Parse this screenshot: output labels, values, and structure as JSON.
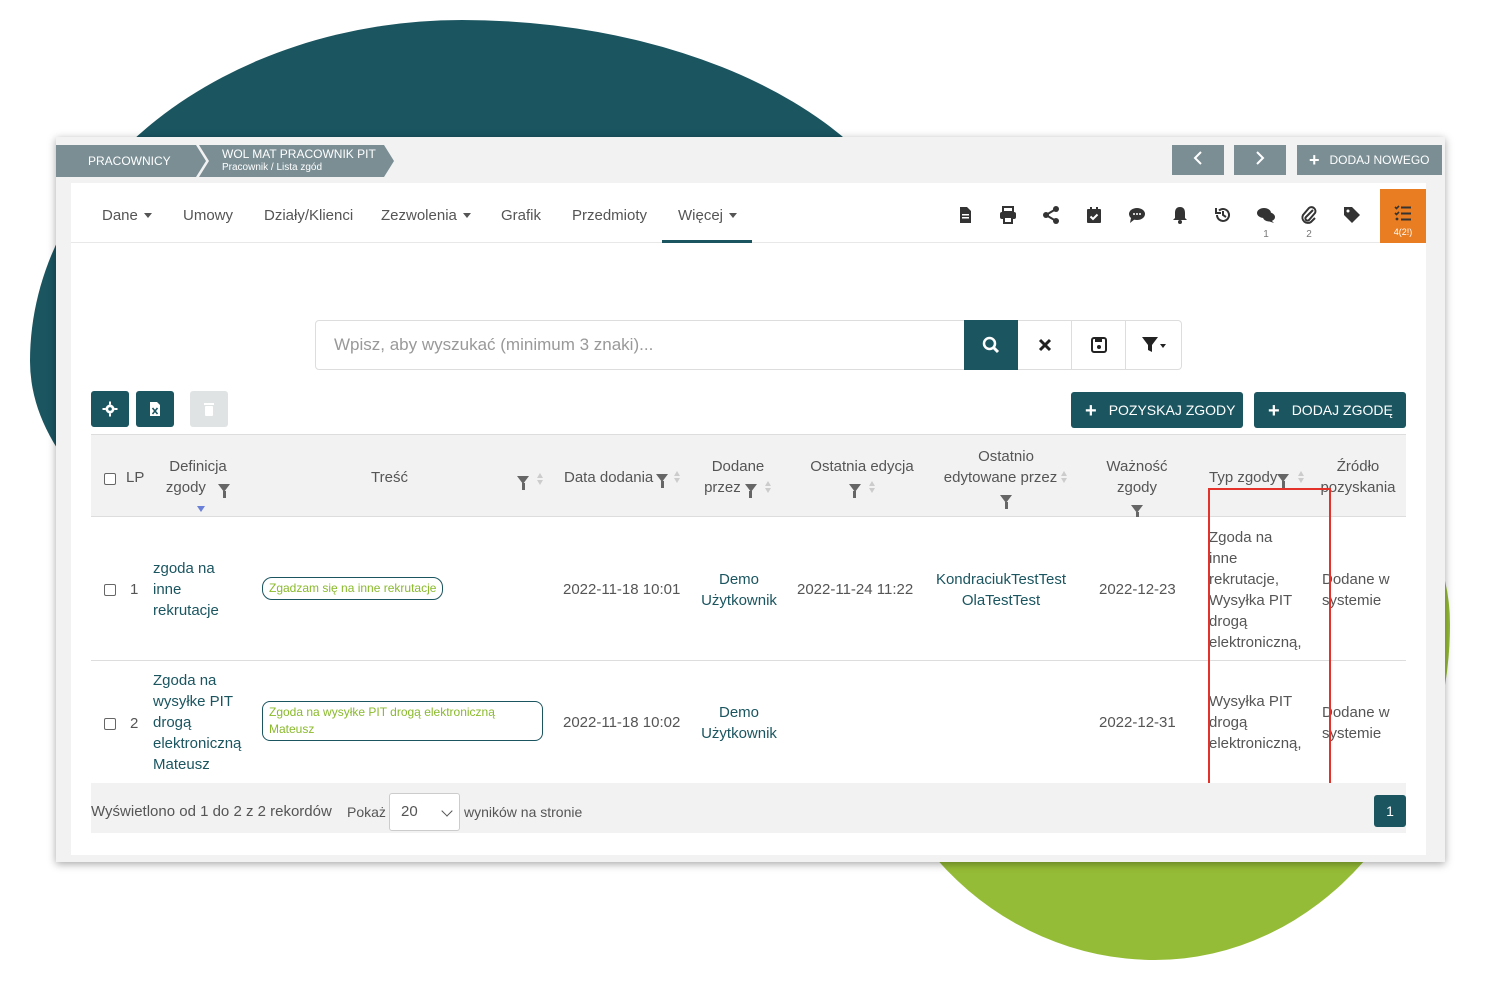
{
  "breadcrumb": {
    "root": "PRACOWNICY",
    "current_title": "WOL MAT PRACOWNIK PIT",
    "current_sub": "Pracownik / Lista zgód"
  },
  "header_buttons": {
    "add_new": "DODAJ NOWEGO"
  },
  "tabs": [
    {
      "label": "Dane"
    },
    {
      "label": "Umowy"
    },
    {
      "label": "Działy/Klienci"
    },
    {
      "label": "Zezwolenia"
    },
    {
      "label": "Grafik"
    },
    {
      "label": "Przedmioty"
    },
    {
      "label": "Więcej"
    }
  ],
  "icon_counts": {
    "comments": "1",
    "attachments": "2",
    "tasks": "4(2!)"
  },
  "search": {
    "placeholder": "Wpisz, aby wyszukać (minimum 3 znaki)..."
  },
  "actions": {
    "obtain": "POZYSKAJ ZGODY",
    "add": "DODAJ ZGODĘ"
  },
  "table": {
    "headers": {
      "lp": "LP",
      "definition_l1": "Definicja",
      "definition_l2": "zgody",
      "content": "Treść",
      "date_added": "Data dodania",
      "added_by_l1": "Dodane",
      "added_by_l2": "przez",
      "last_edit": "Ostatnia edycja",
      "last_edited_by_l1": "Ostatnio",
      "last_edited_by_l2": "edytowane przez",
      "validity": "Ważność zgody",
      "type": "Typ zgody",
      "source_l1": "Źródło",
      "source_l2": "pozyskania"
    },
    "rows": [
      {
        "lp": "1",
        "definition": [
          "zgoda na",
          "inne",
          "rekrutacje"
        ],
        "content": "Zgadzam się na inne rekrutacje",
        "date_added": "2022-11-18 10:01",
        "added_by": [
          "Demo",
          "Użytkownik"
        ],
        "last_edit": "2022-11-24 11:22",
        "last_edited_by": [
          "KondraciukTestTest",
          "OlaTestTest"
        ],
        "validity": "2022-12-23",
        "type": [
          "Zgoda na",
          "inne",
          "rekrutacje,",
          "Wysyłka PIT",
          "drogą",
          "elektroniczną,"
        ],
        "source": [
          "Dodane w",
          "systemie"
        ]
      },
      {
        "lp": "2",
        "definition": [
          "Zgoda na",
          "wysyłke PIT",
          "drogą",
          "elektroniczną",
          "Mateusz"
        ],
        "content": [
          "Zgoda na wysyłke PIT drogą elektroniczną",
          "Mateusz"
        ],
        "date_added": "2022-11-18 10:02",
        "added_by": [
          "Demo",
          "Użytkownik"
        ],
        "last_edit": "",
        "last_edited_by": [
          "",
          ""
        ],
        "validity": "2022-12-31",
        "type": [
          "Wysyłka PIT",
          "drogą",
          "elektroniczną,"
        ],
        "source": [
          "Dodane w",
          "systemie"
        ]
      }
    ]
  },
  "footer": {
    "info": "Wyświetlono od 1 do 2 z 2 rekordów",
    "show": "Pokaż",
    "page_size": "20",
    "per_page": "wyników na stronie",
    "page": "1"
  },
  "colors": {
    "primary": "#1a5560",
    "accent_orange": "#e87d21",
    "green_blob": "#95bc36",
    "highlight_red": "#e3322a",
    "breadcrumb_grey": "#7a8e94"
  }
}
